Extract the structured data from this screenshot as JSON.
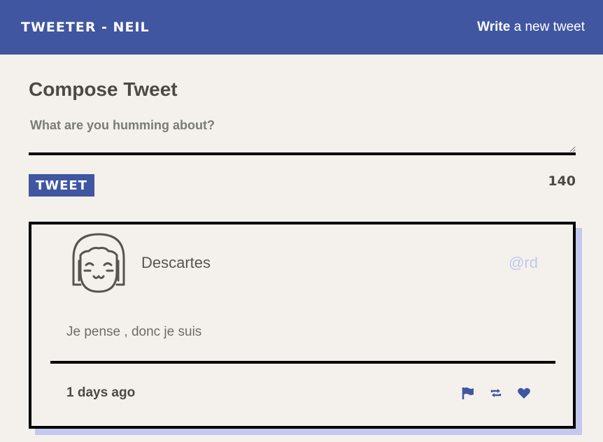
{
  "navbar": {
    "brand": "TWEETER - NEIL",
    "write_bold": "Write",
    "write_rest": " a new tweet"
  },
  "compose": {
    "title": "Compose Tweet",
    "placeholder": "What are you humming about?",
    "button_label": "TWEET",
    "counter": "140"
  },
  "tweet": {
    "author_name": "Descartes",
    "handle": "@rd",
    "text": "Je pense , donc je suis",
    "timestamp": "1 days ago",
    "actions": [
      "flag-icon",
      "retweet-icon",
      "heart-icon"
    ]
  },
  "colors": {
    "primary": "#4056a1",
    "background": "#f4f1ec",
    "shadow": "#c2c8ee",
    "text": "#4a4a43"
  }
}
